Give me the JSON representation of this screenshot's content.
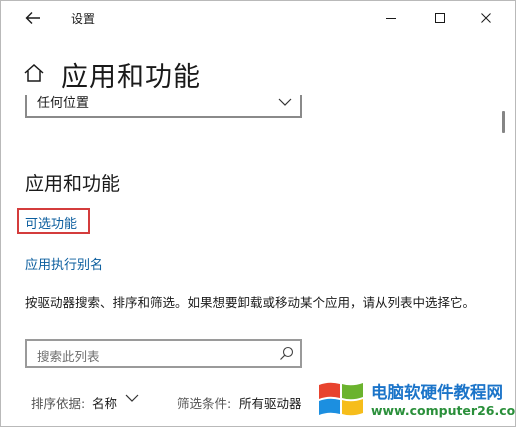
{
  "window": {
    "title": "设置",
    "controls": {
      "minimize": "minimize-icon",
      "maximize": "maximize-icon",
      "close": "close-icon"
    }
  },
  "header": {
    "title": "应用和功能",
    "icon": "home-icon"
  },
  "dropdown": {
    "value": "任何位置"
  },
  "section": {
    "title": "应用和功能",
    "optional_features_link": "可选功能",
    "app_alias_link": "应用执行别名",
    "description": "按驱动器搜索、排序和筛选。如果想要卸载或移动某个应用，请从列表中选择它。"
  },
  "search": {
    "placeholder": "搜索此列表"
  },
  "sort": {
    "label": "排序依据:",
    "value": "名称"
  },
  "filter": {
    "label": "筛选条件:",
    "value": "所有驱动器"
  },
  "watermark": {
    "name": "电脑软硬件教程网",
    "url": "www.computer26.com"
  },
  "colors": {
    "link": "#0a5d9e",
    "highlight_border": "#d43c3c",
    "watermark_blue": "#1b74c9",
    "watermark_green": "#2a8f3a"
  }
}
